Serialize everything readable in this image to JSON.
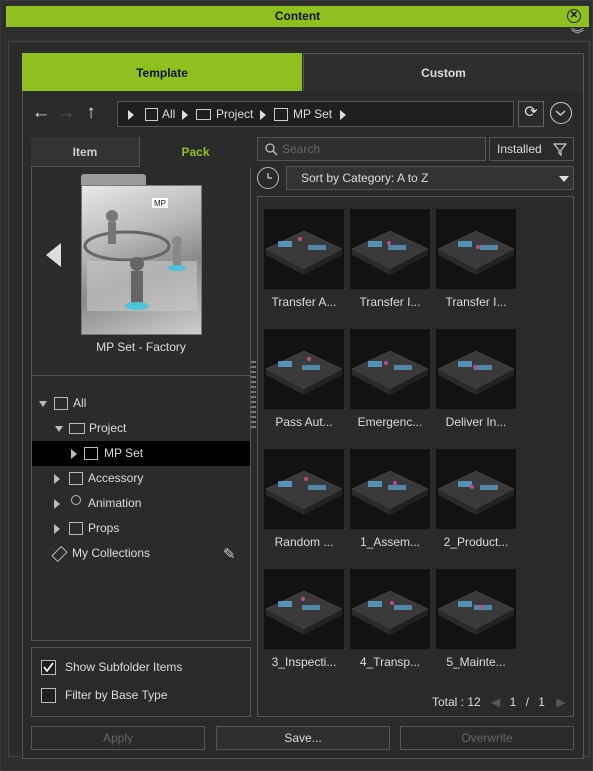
{
  "window": {
    "title": "Content"
  },
  "tabs": {
    "template": "Template",
    "custom": "Custom"
  },
  "breadcrumb": {
    "items": [
      "All",
      "Project",
      "MP Set"
    ]
  },
  "left_tabs": {
    "item": "Item",
    "pack": "Pack"
  },
  "preview": {
    "name": "MP Set - Factory"
  },
  "tree": [
    {
      "label": "All",
      "expanded": true
    },
    {
      "label": "Project",
      "expanded": true
    },
    {
      "label": "MP Set",
      "selected": true
    },
    {
      "label": "Accessory"
    },
    {
      "label": "Animation"
    },
    {
      "label": "Props"
    },
    {
      "label": "My Collections"
    }
  ],
  "options": {
    "show_subfolder": "Show Subfolder Items",
    "show_subfolder_checked": true,
    "filter_base": "Filter by Base Type",
    "filter_base_checked": false
  },
  "search": {
    "placeholder": "Search"
  },
  "filter": {
    "installed": "Installed"
  },
  "sort": {
    "label": "Sort by Category: A to Z"
  },
  "items": [
    "Transfer A...",
    "Transfer I...",
    "Transfer I...",
    "Pass Aut...",
    "Emergenc...",
    "Deliver In...",
    "Random ...",
    "1_Assem...",
    "2_Product...",
    "3_Inspecti...",
    "4_Transp...",
    "5_Mainte..."
  ],
  "footer": {
    "total": "Total : 12",
    "page": "1",
    "sep": "/",
    "pages": "1"
  },
  "buttons": {
    "apply": "Apply",
    "save": "Save...",
    "overwrite": "Overwrite"
  },
  "colors": {
    "accent": "#8ec120",
    "background": "#2b2b2b"
  }
}
